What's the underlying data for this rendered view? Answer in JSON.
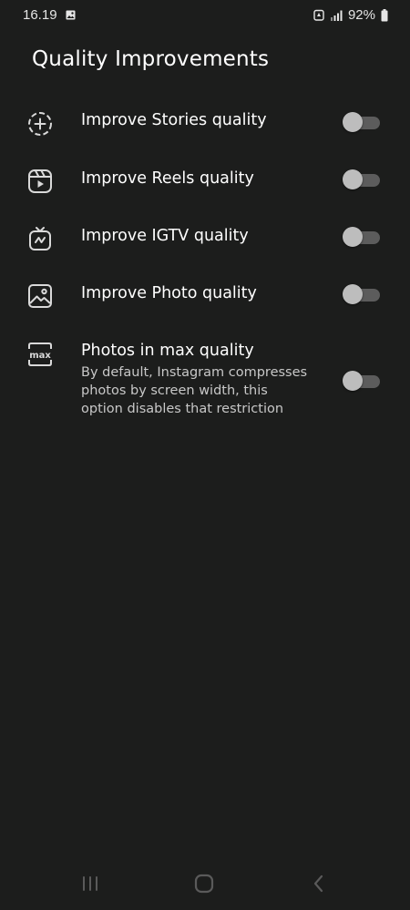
{
  "status_bar": {
    "time": "16.19",
    "battery": "92%",
    "icons": [
      "gallery-icon",
      "battery-saver-icon",
      "signal-icon",
      "battery-icon"
    ]
  },
  "page": {
    "title": "Quality Improvements"
  },
  "settings": [
    {
      "label": "Improve Stories quality",
      "icon": "add-story-icon",
      "enabled": false
    },
    {
      "label": "Improve Reels quality",
      "icon": "reels-icon",
      "enabled": false
    },
    {
      "label": "Improve IGTV quality",
      "icon": "igtv-icon",
      "enabled": false
    },
    {
      "label": "Improve Photo quality",
      "icon": "image-icon",
      "enabled": false
    },
    {
      "label": "Photos in max quality",
      "icon": "max-icon",
      "enabled": false,
      "description_lines": [
        "By default, Instagram compresses",
        "photos by screen width, this",
        "option disables that restriction"
      ]
    }
  ],
  "nav_bar": {
    "buttons": [
      "recents-icon",
      "home-icon",
      "back-icon"
    ]
  },
  "colors": {
    "background": "#1c1d1c",
    "text": "#ffffff",
    "secondary_text": "#c8c8c8",
    "toggle_track": "#5c5c5c",
    "toggle_thumb": "#bdbdbd",
    "icon_stroke": "#d9d9d9"
  }
}
